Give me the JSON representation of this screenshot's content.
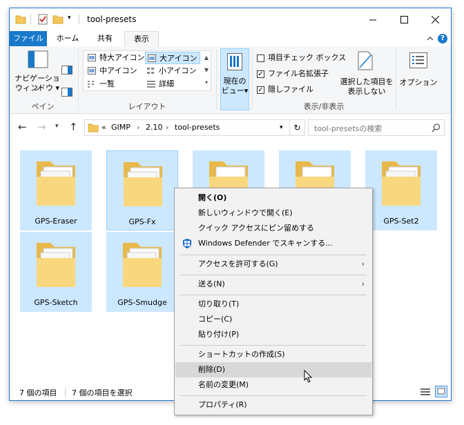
{
  "window": {
    "title": "tool-presets"
  },
  "menubar": {
    "file": "ファイル",
    "home": "ホーム",
    "share": "共有",
    "view": "表示"
  },
  "ribbon": {
    "nav_pane": {
      "label_line1": "ナビゲーション",
      "label_line2": "ウィンドウ"
    },
    "layout_items": {
      "xlarge": "特大アイコン",
      "large": "大アイコン",
      "medium": "中アイコン",
      "small": "小アイコン",
      "list": "一覧",
      "details": "詳細"
    },
    "current_view": {
      "line1": "現在の",
      "line2": "ビュー"
    },
    "checkboxes": {
      "item_checkboxes": "項目チェック ボックス",
      "extensions": "ファイル名拡張子",
      "hidden": "隠しファイル"
    },
    "hide_selected": {
      "line1": "選択した項目を",
      "line2": "表示しない"
    },
    "options": "オプション",
    "groups": {
      "pane": "ペイン",
      "layout": "レイアウト",
      "show_hide": "表示/非表示"
    }
  },
  "navbar": {
    "breadcrumb": [
      "GIMP",
      "2.10",
      "tool-presets"
    ],
    "overflow": "«",
    "search_placeholder": "tool-presetsの検索"
  },
  "folders": [
    "GPS-Eraser",
    "GPS-Fx",
    "",
    "",
    "GPS-Set2",
    "GPS-Sketch",
    "GPS-Smudge"
  ],
  "status": {
    "count": "7 個の項目",
    "selected": "7 個の項目を選択"
  },
  "context_menu": {
    "open": "開く(O)",
    "open_new_window": "新しいウィンドウで開く(E)",
    "pin_quick_access": "クイック アクセスにピン留めする",
    "defender_scan": "Windows Defender でスキャンする...",
    "give_access": "アクセスを許可する(G)",
    "send_to": "送る(N)",
    "cut": "切り取り(T)",
    "copy": "コピー(C)",
    "paste": "貼り付け(P)",
    "create_shortcut": "ショートカットの作成(S)",
    "delete": "削除(D)",
    "rename": "名前の変更(M)",
    "properties": "プロパティ(R)"
  }
}
